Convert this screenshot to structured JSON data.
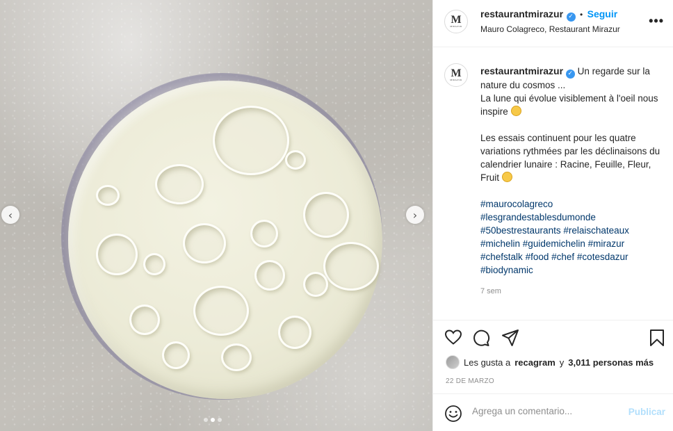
{
  "post": {
    "username": "restaurantmirazur",
    "follow_label": "Seguir",
    "separator": "•",
    "location": "Mauro Colagreco, Restaurant Mirazur",
    "more_label": "•••",
    "avatar_letter": "M",
    "avatar_sub": "MIRAZUR"
  },
  "caption": {
    "username": "restaurantmirazur",
    "line1_rest": "Un regarde sur la nature du cosmos ...",
    "line2": "La lune qui évolue visiblement à l'oeil nous inspire",
    "paragraph2": "Les essais continuent pour les quatre variations rythmées par les déclinaisons du calendrier lunaire : Racine, Feuille, Fleur, Fruit",
    "hashtags": [
      "#maurocolagreco",
      "#lesgrandestablesdumonde",
      "#50bestrestaurants",
      "#relaischateaux",
      "#michelin",
      "#guidemichelin",
      "#mirazur",
      "#chefstalk",
      "#food",
      "#chef",
      "#cotesdazur",
      "#biodynamic"
    ],
    "time_ago": "7 sem"
  },
  "likes": {
    "prefix": "Les gusta a",
    "user": "recagram",
    "middle": "y",
    "count": "3,011 personas más"
  },
  "date": "22 DE MARZO",
  "comment": {
    "placeholder": "Agrega un comentario...",
    "publish_label": "Publicar"
  },
  "carousel": {
    "total": 3,
    "active_index": 1,
    "prev_label": "‹",
    "next_label": "›"
  },
  "icons": [
    "heart-icon",
    "comment-icon",
    "share-icon",
    "bookmark-icon",
    "emoji-icon",
    "verified-badge-icon"
  ],
  "colors": {
    "link": "#0095f6",
    "hashtag": "#00376b",
    "verified": "#3897f0",
    "publish_disabled": "#b2dffc"
  }
}
